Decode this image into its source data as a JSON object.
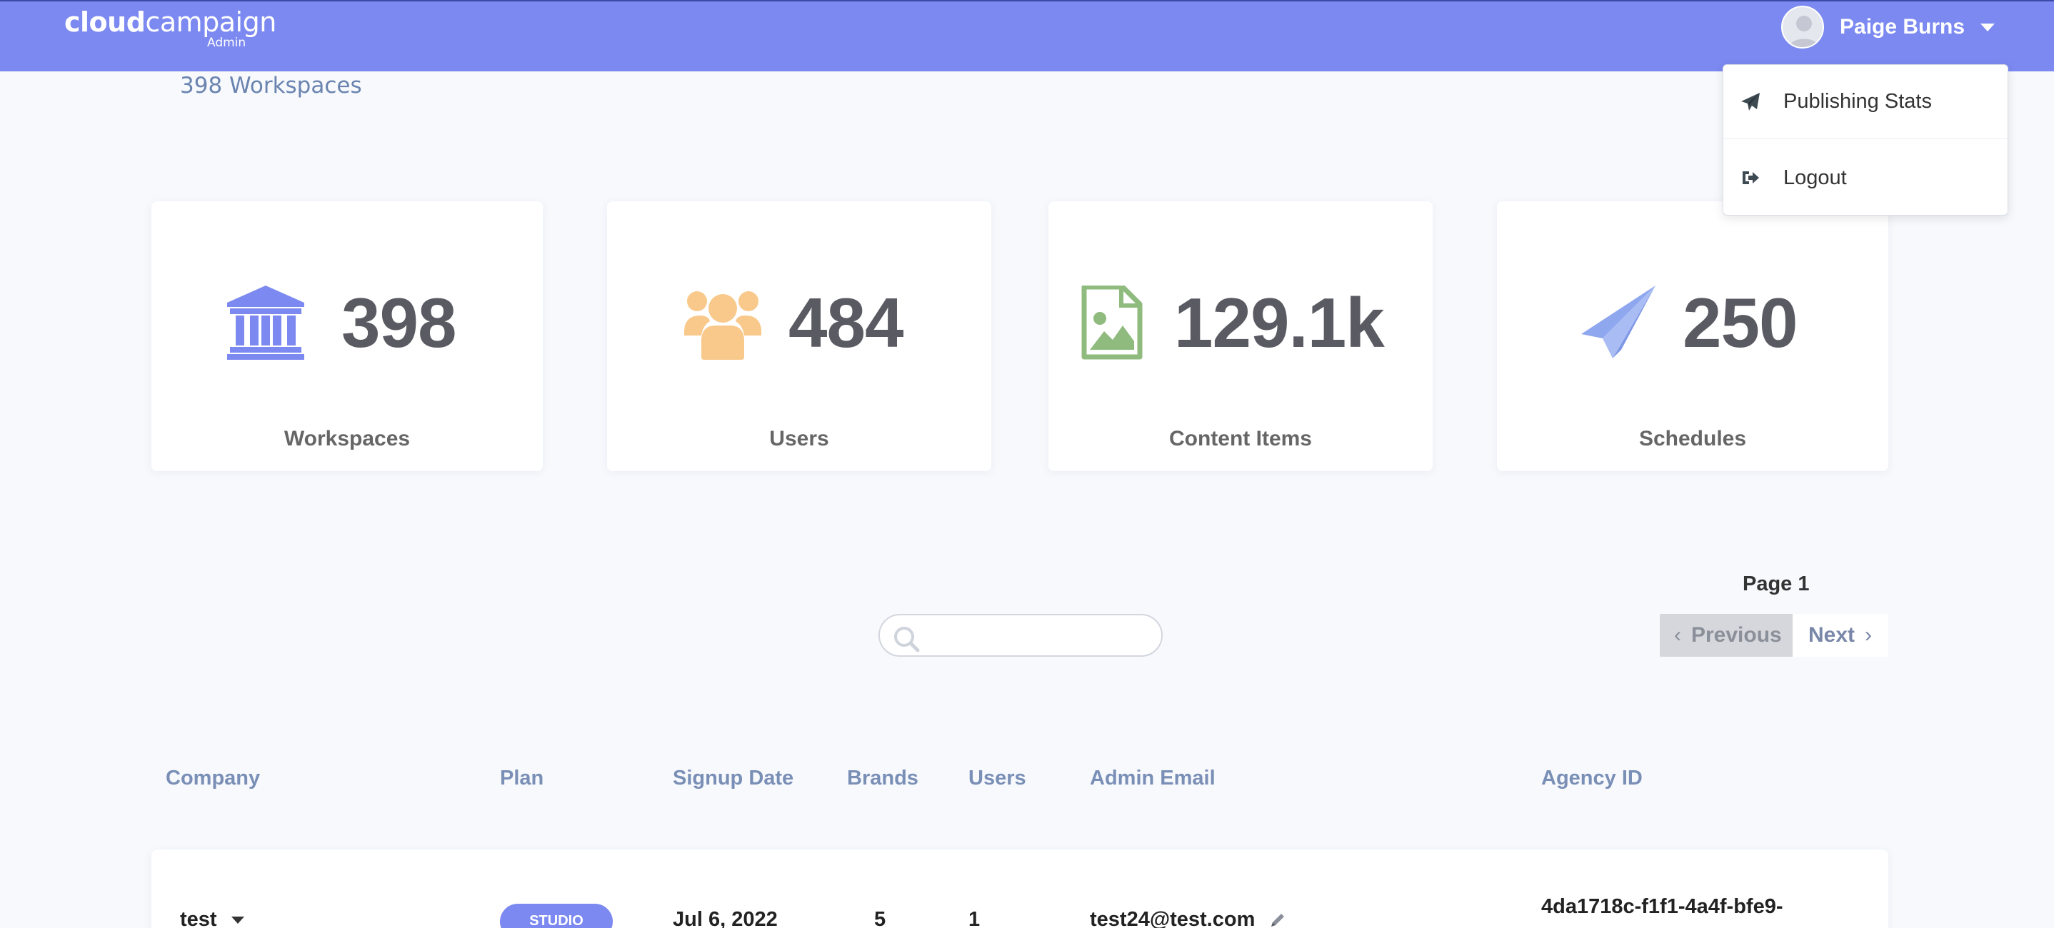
{
  "brand": {
    "logo_bold": "cloud",
    "logo_light": "campaign",
    "logo_sub": "Admin",
    "accent": "#7b89f0"
  },
  "user": {
    "name": "Paige Burns"
  },
  "dropdown": {
    "items": [
      {
        "label": "Publishing Stats",
        "icon": "paper-plane-icon"
      },
      {
        "label": "Logout",
        "icon": "logout-icon"
      }
    ]
  },
  "header": {
    "workspace_count": "398 Workspaces"
  },
  "stats": [
    {
      "value": "398",
      "label": "Workspaces",
      "icon": "bank-icon",
      "color": "#7b89f0"
    },
    {
      "value": "484",
      "label": "Users",
      "icon": "users-icon",
      "color": "#f8c98a"
    },
    {
      "value": "129.1k",
      "label": "Content Items",
      "icon": "image-file-icon",
      "color": "#8fbb7e"
    },
    {
      "value": "250",
      "label": "Schedules",
      "icon": "paper-plane-icon",
      "color": "#8fa7ee"
    }
  ],
  "search": {
    "placeholder": ""
  },
  "pagination": {
    "page_label": "Page 1",
    "previous": "Previous",
    "next": "Next"
  },
  "table": {
    "columns": [
      "Company",
      "Plan",
      "Signup Date",
      "Brands",
      "Users",
      "Admin Email",
      "Agency ID"
    ],
    "rows": [
      {
        "company": "test",
        "plan": "STUDIO",
        "signup_date": "Jul 6, 2022",
        "brands": "5",
        "users": "1",
        "admin_email": "test24@test.com",
        "agency_id": "4da1718c-f1f1-4a4f-bfe9-"
      }
    ]
  }
}
